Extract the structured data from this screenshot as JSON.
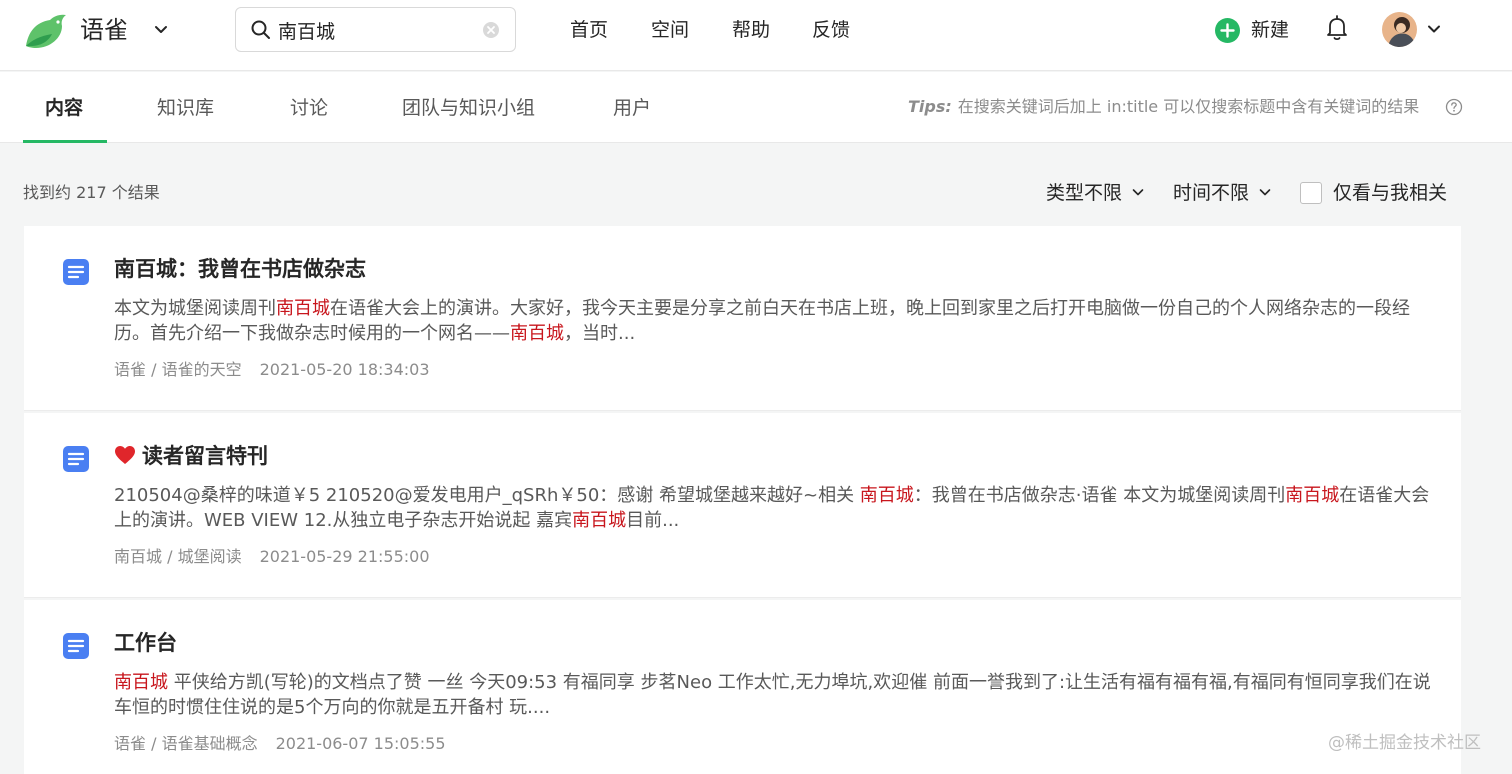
{
  "header": {
    "brand": "语雀",
    "search": {
      "value": "南百城"
    },
    "nav": [
      "首页",
      "空间",
      "帮助",
      "反馈"
    ],
    "new_label": "新建"
  },
  "tabs": [
    {
      "label": "内容",
      "active": true
    },
    {
      "label": "知识库"
    },
    {
      "label": "讨论"
    },
    {
      "label": "团队与知识小组"
    },
    {
      "label": "用户"
    }
  ],
  "tips": {
    "label": "Tips:",
    "text": "在搜索关键词后加上 in:title 可以仅搜索标题中含有关键词的结果"
  },
  "filters": {
    "result_count": "找到约 217 个结果",
    "type": "类型不限",
    "time": "时间不限",
    "only_mine": "仅看与我相关"
  },
  "results": [
    {
      "title": "南百城：我曾在书店做杂志",
      "snippet": [
        {
          "t": "本文为城堡阅读周刊"
        },
        {
          "t": "南百城",
          "hl": true
        },
        {
          "t": "在语雀大会上的演讲。大家好，我今天主要是分享之前白天在书店上班，晚上回到家里之后打开电脑做一份自己的个人网络杂志的一段经历。首先介绍一下我做杂志时候用的一个网名——"
        },
        {
          "t": "南百城",
          "hl": true
        },
        {
          "t": "，当时..."
        }
      ],
      "path": "语雀 / 语雀的天空",
      "time": "2021-05-20 18:34:03"
    },
    {
      "title": "读者留言特刊",
      "snippet": [
        {
          "t": "210504@桑梓的味道￥5 210520@爱发电用户_qSRh￥50：感谢 希望城堡越来越好~相关 "
        },
        {
          "t": "南百城",
          "hl": true
        },
        {
          "t": "：我曾在书店做杂志·语雀 本文为城堡阅读周刊"
        },
        {
          "t": "南百城",
          "hl": true
        },
        {
          "t": "在语雀大会上的演讲。WEB VIEW 12.从独立电子杂志开始说起 嘉宾"
        },
        {
          "t": "南百城",
          "hl": true
        },
        {
          "t": "目前..."
        }
      ],
      "path": "南百城 / 城堡阅读",
      "time": "2021-05-29 21:55:00"
    },
    {
      "title": "工作台",
      "snippet": [
        {
          "t": "南百城",
          "hl": true
        },
        {
          "t": " 平侠给方凯(写轮)的文档点了赞 一丝 今天09:53 有福同享 步茗Neo 工作太忙,无力埠坑,欢迎催 前面一誉我到了:让生活有福有福有福,有福同有恒同享我们在说车恒的时惯住住说的是5个万向的你就是五开备村 玩...."
        }
      ],
      "path": "语雀 / 语雀基础概念",
      "time": "2021-06-07 15:05:55"
    }
  ],
  "watermark": "@稀土掘金技术社区",
  "colors": {
    "accent": "#25b864",
    "highlight": "#c8161d",
    "doc_icon": "#4a7ff2"
  }
}
